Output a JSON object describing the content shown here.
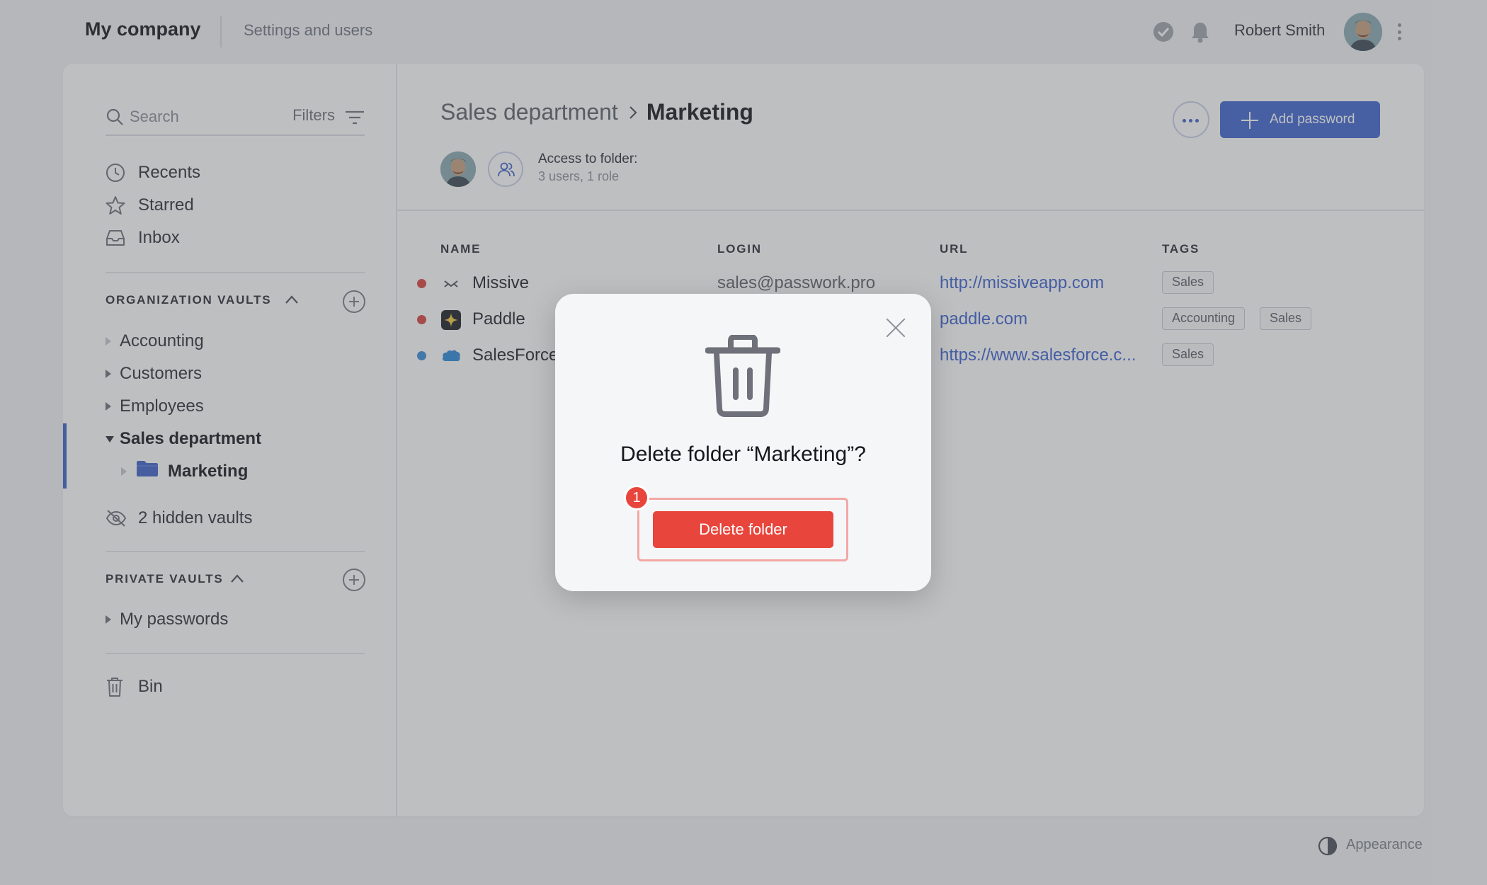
{
  "header": {
    "company": "My company",
    "settings_link": "Settings and users",
    "user_name": "Robert Smith"
  },
  "sidebar": {
    "search_placeholder": "Search",
    "filters_label": "Filters",
    "nav": [
      {
        "label": "Recents",
        "icon": "clock-icon"
      },
      {
        "label": "Starred",
        "icon": "star-icon"
      },
      {
        "label": "Inbox",
        "icon": "inbox-icon"
      }
    ],
    "org_vaults_title": "ORGANIZATION VAULTS",
    "org_vaults": [
      {
        "label": "Accounting"
      },
      {
        "label": "Customers"
      },
      {
        "label": "Employees"
      },
      {
        "label": "Sales department",
        "expanded": true,
        "selected": true
      },
      {
        "label": "Marketing",
        "child": true,
        "selected": true
      }
    ],
    "hidden_vaults": "2 hidden vaults",
    "private_vaults_title": "PRIVATE VAULTS",
    "private_vaults": [
      {
        "label": "My passwords"
      }
    ],
    "bin": "Bin"
  },
  "main": {
    "breadcrumb_parent": "Sales department",
    "breadcrumb_current": "Marketing",
    "access_title": "Access to folder:",
    "access_sub": "3 users, 1 role",
    "add_password": "Add password",
    "columns": {
      "name": "NAME",
      "login": "LOGIN",
      "url": "URL",
      "tags": "TAGS"
    },
    "rows": [
      {
        "name": "Missive",
        "login": "sales@passwork.pro",
        "url": "http://missiveapp.com",
        "tags": [
          "Sales"
        ],
        "dot_color": "#d9453f",
        "icon": "missive-icon"
      },
      {
        "name": "Paddle",
        "login": "",
        "url": "paddle.com",
        "tags": [
          "Accounting",
          "Sales"
        ],
        "dot_color": "#d9453f",
        "icon": "paddle-icon"
      },
      {
        "name": "SalesForce",
        "login": "",
        "url": "https://www.salesforce.c...",
        "tags": [
          "Sales"
        ],
        "dot_color": "#3b8fd9",
        "icon": "salesforce-icon"
      }
    ]
  },
  "footer": {
    "appearance": "Appearance"
  },
  "modal": {
    "title": "Delete folder “Marketing”?",
    "confirm_label": "Delete folder",
    "step_badge": "1"
  },
  "colors": {
    "accent": "#3f66d0",
    "danger": "#e8453c"
  }
}
